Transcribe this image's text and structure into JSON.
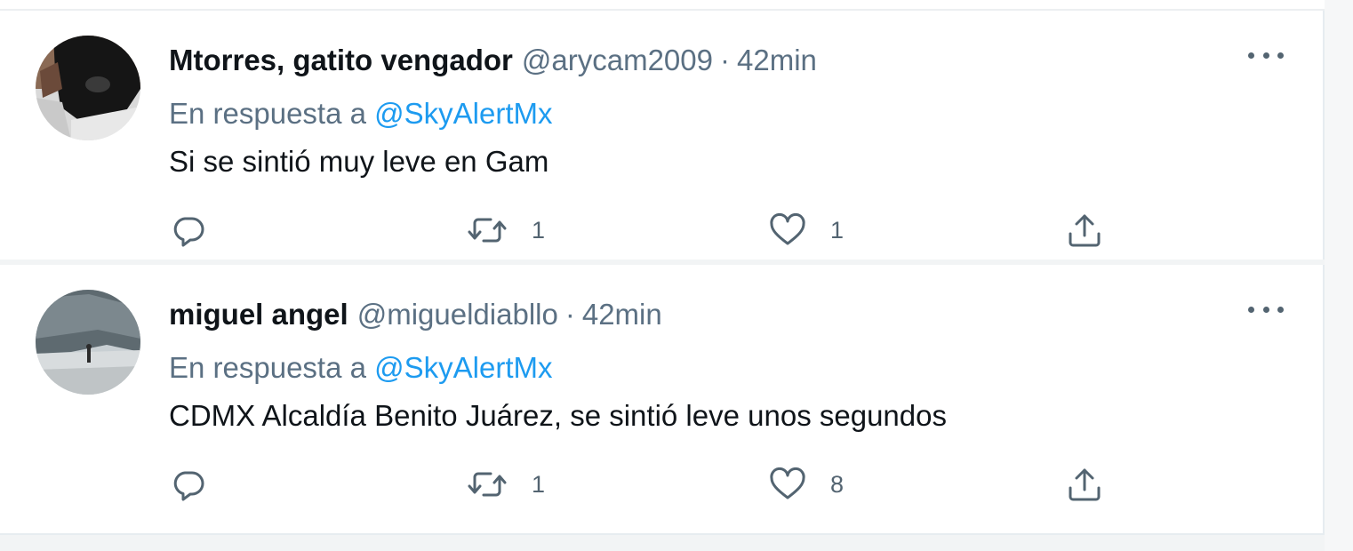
{
  "tweets": [
    {
      "display_name": "Mtorres, gatito vengador",
      "handle": "@arycam2009",
      "separator": "·",
      "time": "42min",
      "reply_prefix": "En respuesta a",
      "reply_to": "@SkyAlertMx",
      "text": "Si se sintió muy leve en Gam",
      "retweets": "1",
      "likes": "1",
      "avatar_icon": "cat-avatar"
    },
    {
      "display_name": "miguel angel",
      "handle": "@migueldiabllo",
      "separator": "·",
      "time": "42min",
      "reply_prefix": "En respuesta a",
      "reply_to": "@SkyAlertMx",
      "text": "CDMX Alcaldía Benito Juárez, se sintió leve unos segundos",
      "retweets": "1",
      "likes": "8",
      "avatar_icon": "landscape-avatar"
    }
  ],
  "colors": {
    "primary_text": "#0f1419",
    "secondary_text": "#5b7083",
    "link": "#1d9bf0",
    "icon": "#536471"
  }
}
